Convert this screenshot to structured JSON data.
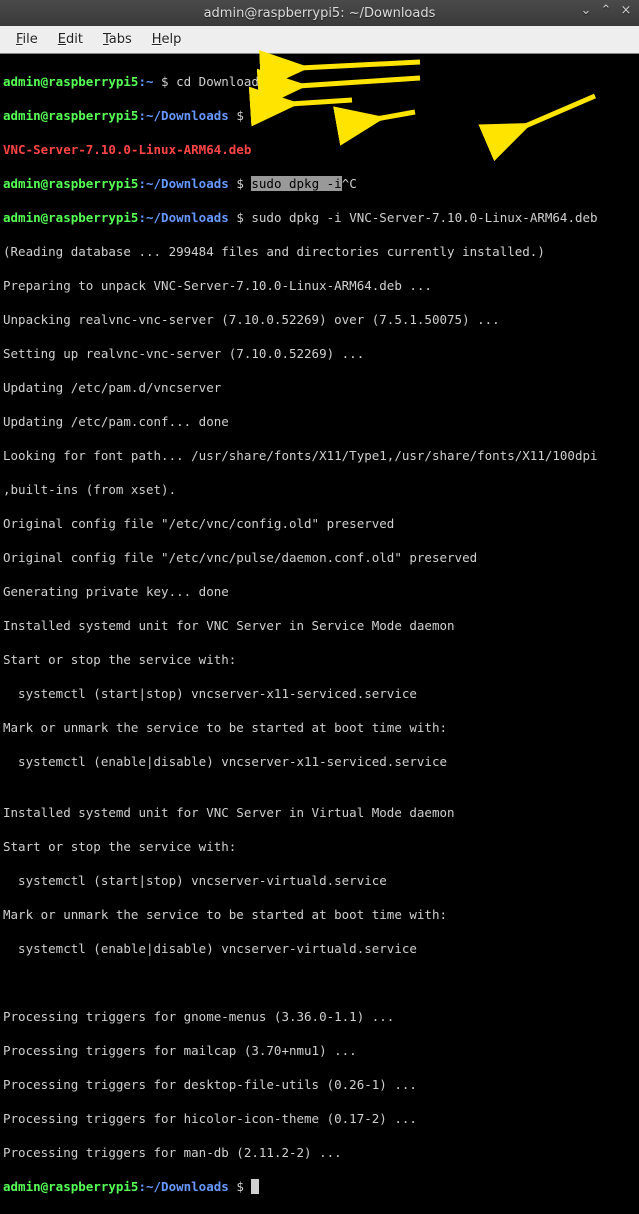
{
  "window": {
    "title": "admin@raspberrypi5: ~/Downloads",
    "controls": {
      "minimize": "⌄",
      "maximize": "⌃",
      "close": "×"
    }
  },
  "menu": {
    "file": "File",
    "edit": "Edit",
    "tabs": "Tabs",
    "help": "Help"
  },
  "prompt": {
    "user_host": "admin@raspberrypi5",
    "colon": ":",
    "tilde": "~",
    "path": "~/Downloads",
    "dollar": " $ "
  },
  "lines": {
    "cmd1": "cd Downloads",
    "cmd2": "ls",
    "file": "VNC-Server-7.10.0-Linux-ARM64.deb",
    "cmd3_sel": "sudo dpkg -i",
    "cmd3_tail": "^C",
    "cmd4": "sudo dpkg -i VNC-Server-7.10.0-Linux-ARM64.deb",
    "o1": "(Reading database ... 299484 files and directories currently installed.)",
    "o2": "Preparing to unpack VNC-Server-7.10.0-Linux-ARM64.deb ...",
    "o3": "Unpacking realvnc-vnc-server (7.10.0.52269) over (7.5.1.50075) ...",
    "o4": "Setting up realvnc-vnc-server (7.10.0.52269) ...",
    "o5": "Updating /etc/pam.d/vncserver",
    "o6": "Updating /etc/pam.conf... done",
    "o7": "Looking for font path... /usr/share/fonts/X11/Type1,/usr/share/fonts/X11/100dpi",
    "o8": ",built-ins (from xset).",
    "o9": "Original config file \"/etc/vnc/config.old\" preserved",
    "o10": "Original config file \"/etc/vnc/pulse/daemon.conf.old\" preserved",
    "o11": "Generating private key... done",
    "o12": "Installed systemd unit for VNC Server in Service Mode daemon",
    "o13": "Start or stop the service with:",
    "o14": "  systemctl (start|stop) vncserver-x11-serviced.service",
    "o15": "Mark or unmark the service to be started at boot time with:",
    "o16": "  systemctl (enable|disable) vncserver-x11-serviced.service",
    "o17": "",
    "o18": "Installed systemd unit for VNC Server in Virtual Mode daemon",
    "o19": "Start or stop the service with:",
    "o20": "  systemctl (start|stop) vncserver-virtuald.service",
    "o21": "Mark or unmark the service to be started at boot time with:",
    "o22": "  systemctl (enable|disable) vncserver-virtuald.service",
    "o23": "",
    "o24": "",
    "o25": "Processing triggers for gnome-menus (3.36.0-1.1) ...",
    "o26": "Processing triggers for mailcap (3.70+nmu1) ...",
    "o27": "Processing triggers for desktop-file-utils (0.26-1) ...",
    "o28": "Processing triggers for hicolor-icon-theme (0.17-2) ...",
    "o29": "Processing triggers for man-db (2.11.2-2) ..."
  }
}
